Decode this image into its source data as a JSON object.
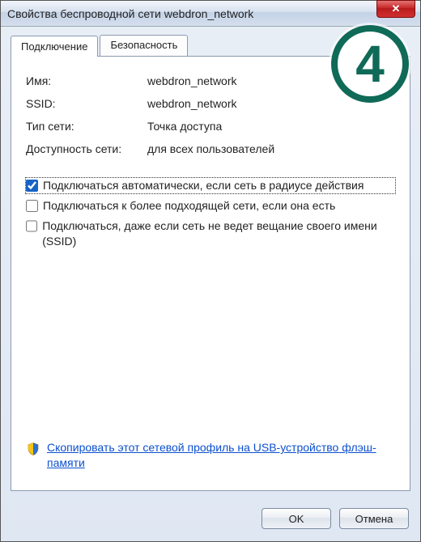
{
  "window": {
    "title": "Свойства беспроводной сети webdron_network",
    "close_label": "✕"
  },
  "tabs": {
    "connection": "Подключение",
    "security": "Безопасность"
  },
  "info": {
    "name_label": "Имя:",
    "name_value": "webdron_network",
    "ssid_label": "SSID:",
    "ssid_value": "webdron_network",
    "nettype_label": "Тип сети:",
    "nettype_value": "Точка доступа",
    "avail_label": "Доступность сети:",
    "avail_value": "для всех пользователей"
  },
  "checks": {
    "auto_label": "Подключаться автоматически, если сеть в радиусе действия",
    "auto_checked": true,
    "prefer_label": "Подключаться к более подходящей сети, если она есть",
    "prefer_checked": false,
    "hidden_label": "Подключаться, даже если сеть не ведет вещание своего имени (SSID)",
    "hidden_checked": false
  },
  "link": {
    "text": "Скопировать этот сетевой профиль на USB-устройство флэш-памяти"
  },
  "buttons": {
    "ok": "OK",
    "cancel": "Отмена"
  },
  "badge": {
    "number": "4"
  }
}
